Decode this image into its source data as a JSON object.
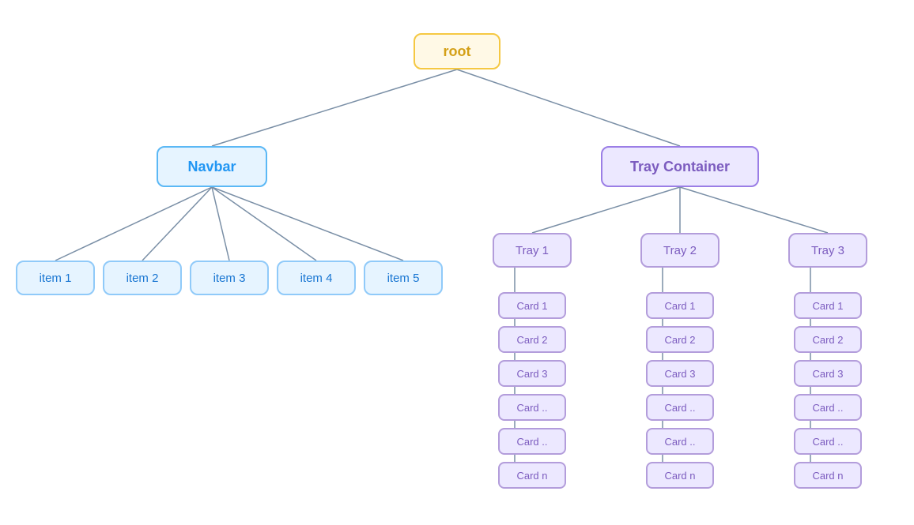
{
  "root": {
    "label": "root"
  },
  "navbar": {
    "label": "Navbar",
    "items": [
      {
        "label": "item 1"
      },
      {
        "label": "item 2"
      },
      {
        "label": "item 3"
      },
      {
        "label": "item 4"
      },
      {
        "label": "item 5"
      }
    ]
  },
  "trayContainer": {
    "label": "Tray Container",
    "trays": [
      {
        "label": "Tray 1",
        "cards": [
          "Card 1",
          "Card 2",
          "Card 3",
          "Card ..",
          "Card ..",
          "Card n"
        ]
      },
      {
        "label": "Tray 2",
        "cards": [
          "Card 1",
          "Card 2",
          "Card 3",
          "Card ..",
          "Card ..",
          "Card n"
        ]
      },
      {
        "label": "Tray 3",
        "cards": [
          "Card 1",
          "Card 2",
          "Card 3",
          "Card ..",
          "Card ..",
          "Card n"
        ]
      }
    ]
  },
  "colors": {
    "line": "#7a8fa6"
  }
}
